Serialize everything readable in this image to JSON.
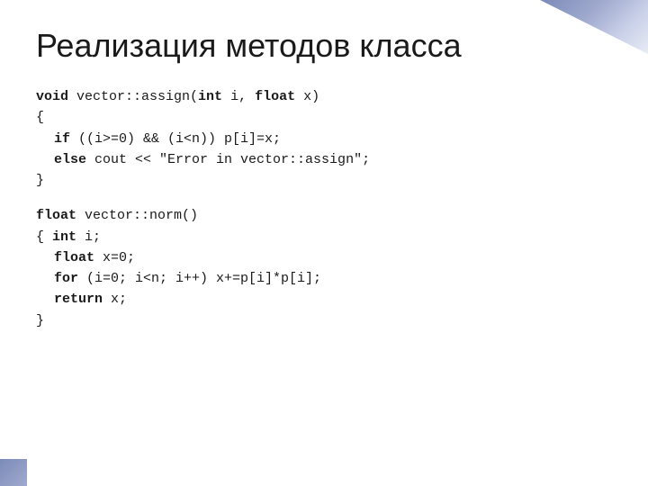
{
  "slide": {
    "title": "Реализация методов класса",
    "code_sections": [
      {
        "id": "assign",
        "lines": [
          {
            "text": "void vector::assign(int i, float x)",
            "bold_parts": [
              "void",
              "int",
              "float"
            ],
            "indent": 0
          },
          {
            "text": "{",
            "indent": 0
          },
          {
            "text": "if ((i>=0) && (i<n)) p[i]=x;",
            "bold_parts": [
              "if"
            ],
            "indent": 1
          },
          {
            "text": "else cout << \"Error in vector::assign\";",
            "bold_parts": [
              "else"
            ],
            "indent": 1
          },
          {
            "text": "}",
            "indent": 0
          }
        ]
      },
      {
        "id": "norm",
        "lines": [
          {
            "text": "float vector::norm()",
            "bold_parts": [
              "float"
            ],
            "indent": 0
          },
          {
            "text": "{ int i;",
            "bold_parts": [
              "int"
            ],
            "indent": 0
          },
          {
            "text": "float x=0;",
            "bold_parts": [
              "float"
            ],
            "indent": 1
          },
          {
            "text": "for (i=0; i<n; i++) x+=p[i]*p[i];",
            "bold_parts": [
              "for"
            ],
            "indent": 1
          },
          {
            "text": "return x;",
            "bold_parts": [
              "return"
            ],
            "indent": 1
          },
          {
            "text": "}",
            "indent": 0
          }
        ]
      }
    ]
  }
}
